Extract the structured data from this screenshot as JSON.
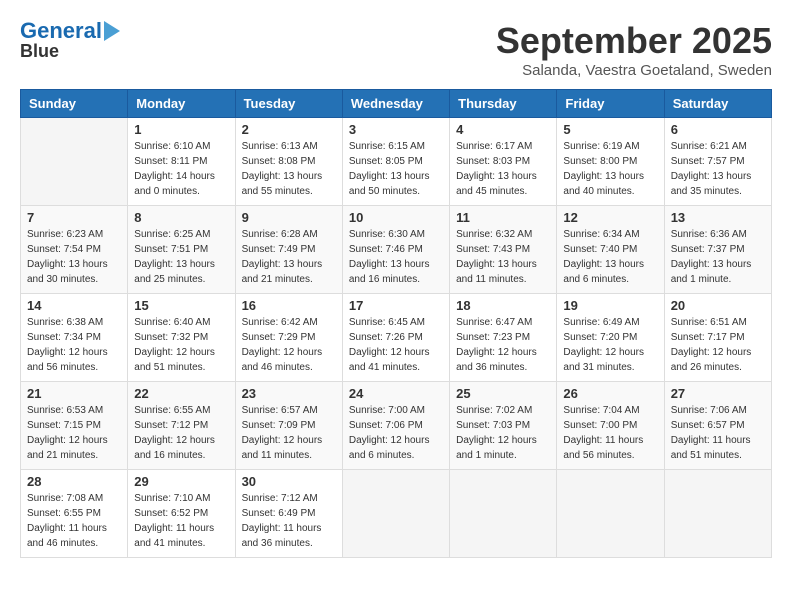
{
  "header": {
    "logo_line1": "General",
    "logo_line2": "Blue",
    "month": "September 2025",
    "location": "Salanda, Vaestra Goetaland, Sweden"
  },
  "weekdays": [
    "Sunday",
    "Monday",
    "Tuesday",
    "Wednesday",
    "Thursday",
    "Friday",
    "Saturday"
  ],
  "weeks": [
    [
      {
        "day": "",
        "info": ""
      },
      {
        "day": "1",
        "info": "Sunrise: 6:10 AM\nSunset: 8:11 PM\nDaylight: 14 hours\nand 0 minutes."
      },
      {
        "day": "2",
        "info": "Sunrise: 6:13 AM\nSunset: 8:08 PM\nDaylight: 13 hours\nand 55 minutes."
      },
      {
        "day": "3",
        "info": "Sunrise: 6:15 AM\nSunset: 8:05 PM\nDaylight: 13 hours\nand 50 minutes."
      },
      {
        "day": "4",
        "info": "Sunrise: 6:17 AM\nSunset: 8:03 PM\nDaylight: 13 hours\nand 45 minutes."
      },
      {
        "day": "5",
        "info": "Sunrise: 6:19 AM\nSunset: 8:00 PM\nDaylight: 13 hours\nand 40 minutes."
      },
      {
        "day": "6",
        "info": "Sunrise: 6:21 AM\nSunset: 7:57 PM\nDaylight: 13 hours\nand 35 minutes."
      }
    ],
    [
      {
        "day": "7",
        "info": "Sunrise: 6:23 AM\nSunset: 7:54 PM\nDaylight: 13 hours\nand 30 minutes."
      },
      {
        "day": "8",
        "info": "Sunrise: 6:25 AM\nSunset: 7:51 PM\nDaylight: 13 hours\nand 25 minutes."
      },
      {
        "day": "9",
        "info": "Sunrise: 6:28 AM\nSunset: 7:49 PM\nDaylight: 13 hours\nand 21 minutes."
      },
      {
        "day": "10",
        "info": "Sunrise: 6:30 AM\nSunset: 7:46 PM\nDaylight: 13 hours\nand 16 minutes."
      },
      {
        "day": "11",
        "info": "Sunrise: 6:32 AM\nSunset: 7:43 PM\nDaylight: 13 hours\nand 11 minutes."
      },
      {
        "day": "12",
        "info": "Sunrise: 6:34 AM\nSunset: 7:40 PM\nDaylight: 13 hours\nand 6 minutes."
      },
      {
        "day": "13",
        "info": "Sunrise: 6:36 AM\nSunset: 7:37 PM\nDaylight: 13 hours\nand 1 minute."
      }
    ],
    [
      {
        "day": "14",
        "info": "Sunrise: 6:38 AM\nSunset: 7:34 PM\nDaylight: 12 hours\nand 56 minutes."
      },
      {
        "day": "15",
        "info": "Sunrise: 6:40 AM\nSunset: 7:32 PM\nDaylight: 12 hours\nand 51 minutes."
      },
      {
        "day": "16",
        "info": "Sunrise: 6:42 AM\nSunset: 7:29 PM\nDaylight: 12 hours\nand 46 minutes."
      },
      {
        "day": "17",
        "info": "Sunrise: 6:45 AM\nSunset: 7:26 PM\nDaylight: 12 hours\nand 41 minutes."
      },
      {
        "day": "18",
        "info": "Sunrise: 6:47 AM\nSunset: 7:23 PM\nDaylight: 12 hours\nand 36 minutes."
      },
      {
        "day": "19",
        "info": "Sunrise: 6:49 AM\nSunset: 7:20 PM\nDaylight: 12 hours\nand 31 minutes."
      },
      {
        "day": "20",
        "info": "Sunrise: 6:51 AM\nSunset: 7:17 PM\nDaylight: 12 hours\nand 26 minutes."
      }
    ],
    [
      {
        "day": "21",
        "info": "Sunrise: 6:53 AM\nSunset: 7:15 PM\nDaylight: 12 hours\nand 21 minutes."
      },
      {
        "day": "22",
        "info": "Sunrise: 6:55 AM\nSunset: 7:12 PM\nDaylight: 12 hours\nand 16 minutes."
      },
      {
        "day": "23",
        "info": "Sunrise: 6:57 AM\nSunset: 7:09 PM\nDaylight: 12 hours\nand 11 minutes."
      },
      {
        "day": "24",
        "info": "Sunrise: 7:00 AM\nSunset: 7:06 PM\nDaylight: 12 hours\nand 6 minutes."
      },
      {
        "day": "25",
        "info": "Sunrise: 7:02 AM\nSunset: 7:03 PM\nDaylight: 12 hours\nand 1 minute."
      },
      {
        "day": "26",
        "info": "Sunrise: 7:04 AM\nSunset: 7:00 PM\nDaylight: 11 hours\nand 56 minutes."
      },
      {
        "day": "27",
        "info": "Sunrise: 7:06 AM\nSunset: 6:57 PM\nDaylight: 11 hours\nand 51 minutes."
      }
    ],
    [
      {
        "day": "28",
        "info": "Sunrise: 7:08 AM\nSunset: 6:55 PM\nDaylight: 11 hours\nand 46 minutes."
      },
      {
        "day": "29",
        "info": "Sunrise: 7:10 AM\nSunset: 6:52 PM\nDaylight: 11 hours\nand 41 minutes."
      },
      {
        "day": "30",
        "info": "Sunrise: 7:12 AM\nSunset: 6:49 PM\nDaylight: 11 hours\nand 36 minutes."
      },
      {
        "day": "",
        "info": ""
      },
      {
        "day": "",
        "info": ""
      },
      {
        "day": "",
        "info": ""
      },
      {
        "day": "",
        "info": ""
      }
    ]
  ]
}
